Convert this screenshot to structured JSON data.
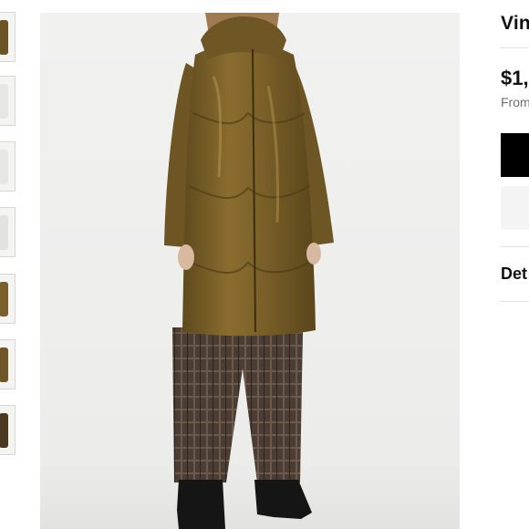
{
  "thumbnails": [
    {
      "name": "thumbnail-1",
      "color": "#6b5424"
    },
    {
      "name": "thumbnail-2",
      "color": "#e6e6e4"
    },
    {
      "name": "thumbnail-3",
      "color": "#e6e6e4"
    },
    {
      "name": "thumbnail-4",
      "color": "#e2e2e0"
    },
    {
      "name": "thumbnail-5",
      "color": "#7a5f2b"
    },
    {
      "name": "thumbnail-6",
      "color": "#6e5628"
    },
    {
      "name": "thumbnail-7",
      "color": "#4a3a22"
    }
  ],
  "product": {
    "brand_partial": "Vin",
    "price_partial": "$1,",
    "from_partial": "From",
    "details_partial": "Det"
  },
  "colors": {
    "coat": "#7d6228",
    "pants": "#5a4a3e",
    "boots": "#151515",
    "primary_button": "#000000",
    "secondary_button": "#f4f4f4"
  }
}
